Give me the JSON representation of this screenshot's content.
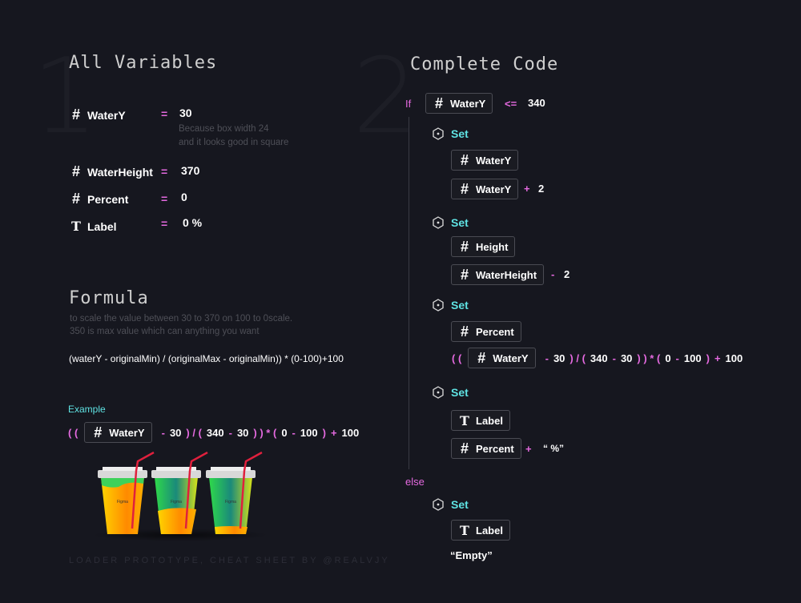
{
  "watermarks": {
    "one": "1",
    "two": "2"
  },
  "variables": {
    "title": "All Variables",
    "items": [
      {
        "icon": "hash-icon",
        "name": "WaterY",
        "eq": "=",
        "value": "30"
      },
      {
        "icon": "hash-icon",
        "name": "WaterHeight",
        "eq": "=",
        "value": "370"
      },
      {
        "icon": "hash-icon",
        "name": "Percent",
        "eq": "=",
        "value": "0"
      },
      {
        "icon": "text-icon",
        "name": "Label",
        "eq": "=",
        "value": "0 %"
      }
    ],
    "note_line1": "Because box width 24",
    "note_line2": "and it looks good in square"
  },
  "formula": {
    "title": "Formula",
    "desc_line1": "to scale the value between 30 to 370 on 100 to 0scale.",
    "desc_line2": "350 is max value which can anything you want",
    "expression": "(waterY - originalMin) / (originalMax - originalMin)) * (0-100)+100",
    "example_label": "Example",
    "cup_brand": "Figma"
  },
  "expr_tokens": [
    {
      "t": "op",
      "v": "( ("
    },
    {
      "t": "var",
      "v": "WaterY"
    },
    {
      "t": "op",
      "v": "-"
    },
    {
      "t": "num",
      "v": "30"
    },
    {
      "t": "op",
      "v": ") / ("
    },
    {
      "t": "num",
      "v": "340"
    },
    {
      "t": "op",
      "v": "-"
    },
    {
      "t": "num",
      "v": "30"
    },
    {
      "t": "op",
      "v": ") ) * ("
    },
    {
      "t": "num",
      "v": "0"
    },
    {
      "t": "op",
      "v": "-"
    },
    {
      "t": "num",
      "v": "100"
    },
    {
      "t": "op",
      "v": ")"
    },
    {
      "t": "op",
      "v": "+"
    },
    {
      "t": "num",
      "v": "100"
    }
  ],
  "code": {
    "title": "Complete Code",
    "if_kw": "If",
    "if_var": "WaterY",
    "if_op": "<=",
    "if_val": "340",
    "set_kw": "Set",
    "s1_target": "WaterY",
    "s1_var": "WaterY",
    "s1_op": "+",
    "s1_val": "2",
    "s2_target": "Height",
    "s2_var": "WaterHeight",
    "s2_op": "-",
    "s2_val": "2",
    "s3_target": "Percent",
    "s4_target": "Label",
    "s4_var": "Percent",
    "s4_op": "+",
    "s4_val": "“ %”",
    "else_kw": "else",
    "s5_target": "Label",
    "s5_val": "“Empty”"
  },
  "footer": "LOADER PROTOTYPE, CHEAT SHEET BY @REALVJY",
  "colors": {
    "bg": "#16171f",
    "pink": "#e56ae0",
    "cyan": "#5fe3e3"
  }
}
